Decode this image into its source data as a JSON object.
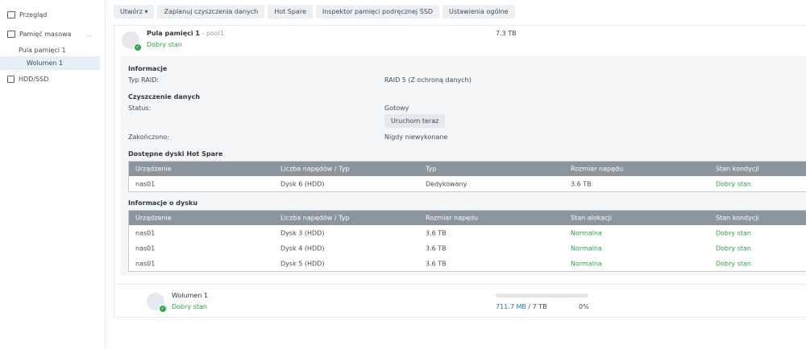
{
  "sidebar": {
    "items": [
      {
        "label": "Przegląd"
      },
      {
        "label": "Pamięć masowa"
      },
      {
        "label": "Pula pamięci 1"
      },
      {
        "label": "Wolumen 1"
      },
      {
        "label": "HDD/SSD"
      }
    ]
  },
  "toolbar": {
    "create": "Utwórz ▾",
    "schedule": "Zaplanuj czyszczenia danych",
    "hotspare": "Hot Spare",
    "ssd": "Inspektor pamięci podręcznej SSD",
    "settings": "Ustawienia ogólne"
  },
  "pool": {
    "name": "Pula pamięci 1",
    "sep": " - ",
    "id": "pool1",
    "status": "Dobry stan",
    "size": "7.3 TB",
    "info_title": "Informacje",
    "raid_label": "Typ RAID:",
    "raid_value": "RAID 5 (Z ochroną danych)",
    "scrub_title": "Czyszczenie danych",
    "scrub_status_label": "Status:",
    "scrub_status_value": "Gotowy",
    "run_now": "Uruchom teraz",
    "finished_label": "Zakończono:",
    "finished_value": "Nigdy niewykonane",
    "hotspare_title": "Dostępne dyski Hot Spare",
    "hotspare_headers": [
      "Urządzenie",
      "Liczba napędów / Typ",
      "Typ",
      "Rozmiar napędu",
      "Stan kondycji"
    ],
    "hotspare_rows": [
      [
        "nas01",
        "Dysk 6 (HDD)",
        "Dedykowany",
        "3.6 TB",
        "Dobry stan"
      ]
    ],
    "disk_title": "Informacje o dysku",
    "disk_headers": [
      "Urządzenie",
      "Liczba napędów / Typ",
      "Rozmiar napędu",
      "Stan alokacji",
      "Stan kondycji"
    ],
    "disk_rows": [
      [
        "nas01",
        "Dysk 3 (HDD)",
        "3.6 TB",
        "Normalna",
        "Dobry stan"
      ],
      [
        "nas01",
        "Dysk 4 (HDD)",
        "3.6 TB",
        "Normalna",
        "Dobry stan"
      ],
      [
        "nas01",
        "Dysk 5 (HDD)",
        "3.6 TB",
        "Normalna",
        "Dobry stan"
      ]
    ]
  },
  "volume": {
    "name": "Wolumen 1",
    "status": "Dobry stan",
    "used": "711.7 MB",
    "total": " / 7 TB",
    "percent": "0%",
    "usage_fraction": 0.0001
  },
  "colors": {
    "good": "#2e9e3f",
    "link": "#2778b5",
    "header": "#8c949c"
  }
}
